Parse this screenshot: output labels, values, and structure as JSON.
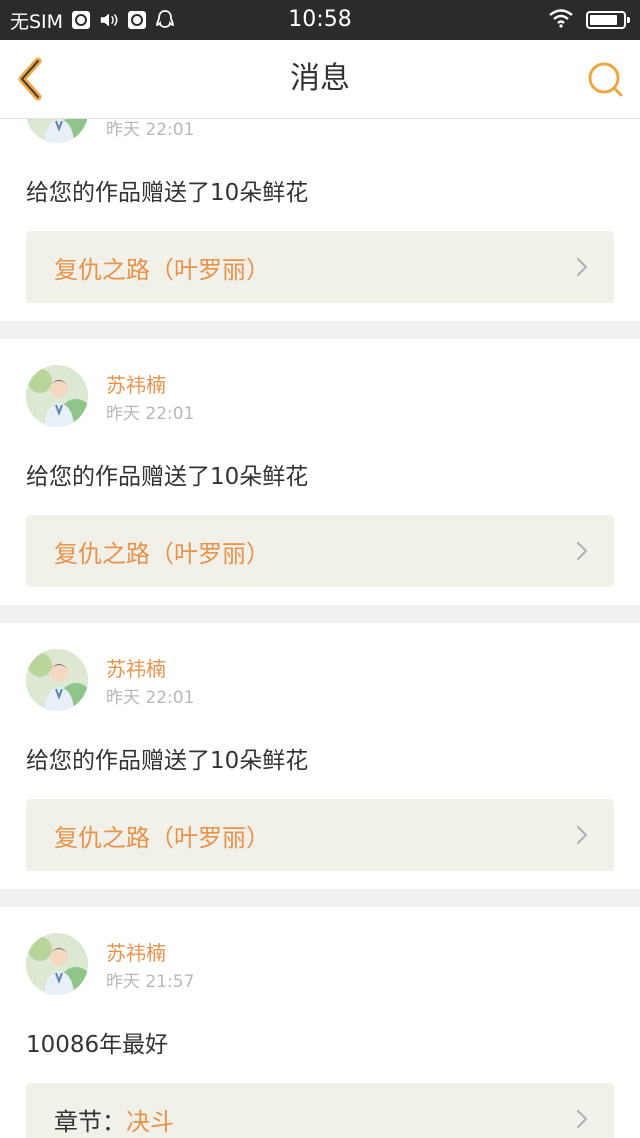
{
  "status_bar": {
    "carrier": "无SIM",
    "time": "10:58",
    "icons": [
      "qq-square-icon",
      "volume-icon",
      "qq-square-icon",
      "qq-penguin-icon",
      "wifi-icon",
      "battery-icon"
    ],
    "battery_level": 0.85
  },
  "nav": {
    "title": "消息",
    "back_icon": "chevron-left-icon",
    "search_icon": "search-icon",
    "accent_color": "#f0a640"
  },
  "messages": [
    {
      "username": "",
      "time": "昨天 22:01",
      "text": "给您的作品赠送了10朵鲜花",
      "work_label": "",
      "work_title": "复仇之路（叶罗丽）"
    },
    {
      "username": "苏祎楠",
      "time": "昨天 22:01",
      "text": "给您的作品赠送了10朵鲜花",
      "work_label": "",
      "work_title": "复仇之路（叶罗丽）"
    },
    {
      "username": "苏祎楠",
      "time": "昨天 22:01",
      "text": "给您的作品赠送了10朵鲜花",
      "work_label": "",
      "work_title": "复仇之路（叶罗丽）"
    },
    {
      "username": "苏祎楠",
      "time": "昨天 21:57",
      "text": "10086年最好",
      "work_label": "章节：",
      "work_title": "决斗"
    }
  ]
}
